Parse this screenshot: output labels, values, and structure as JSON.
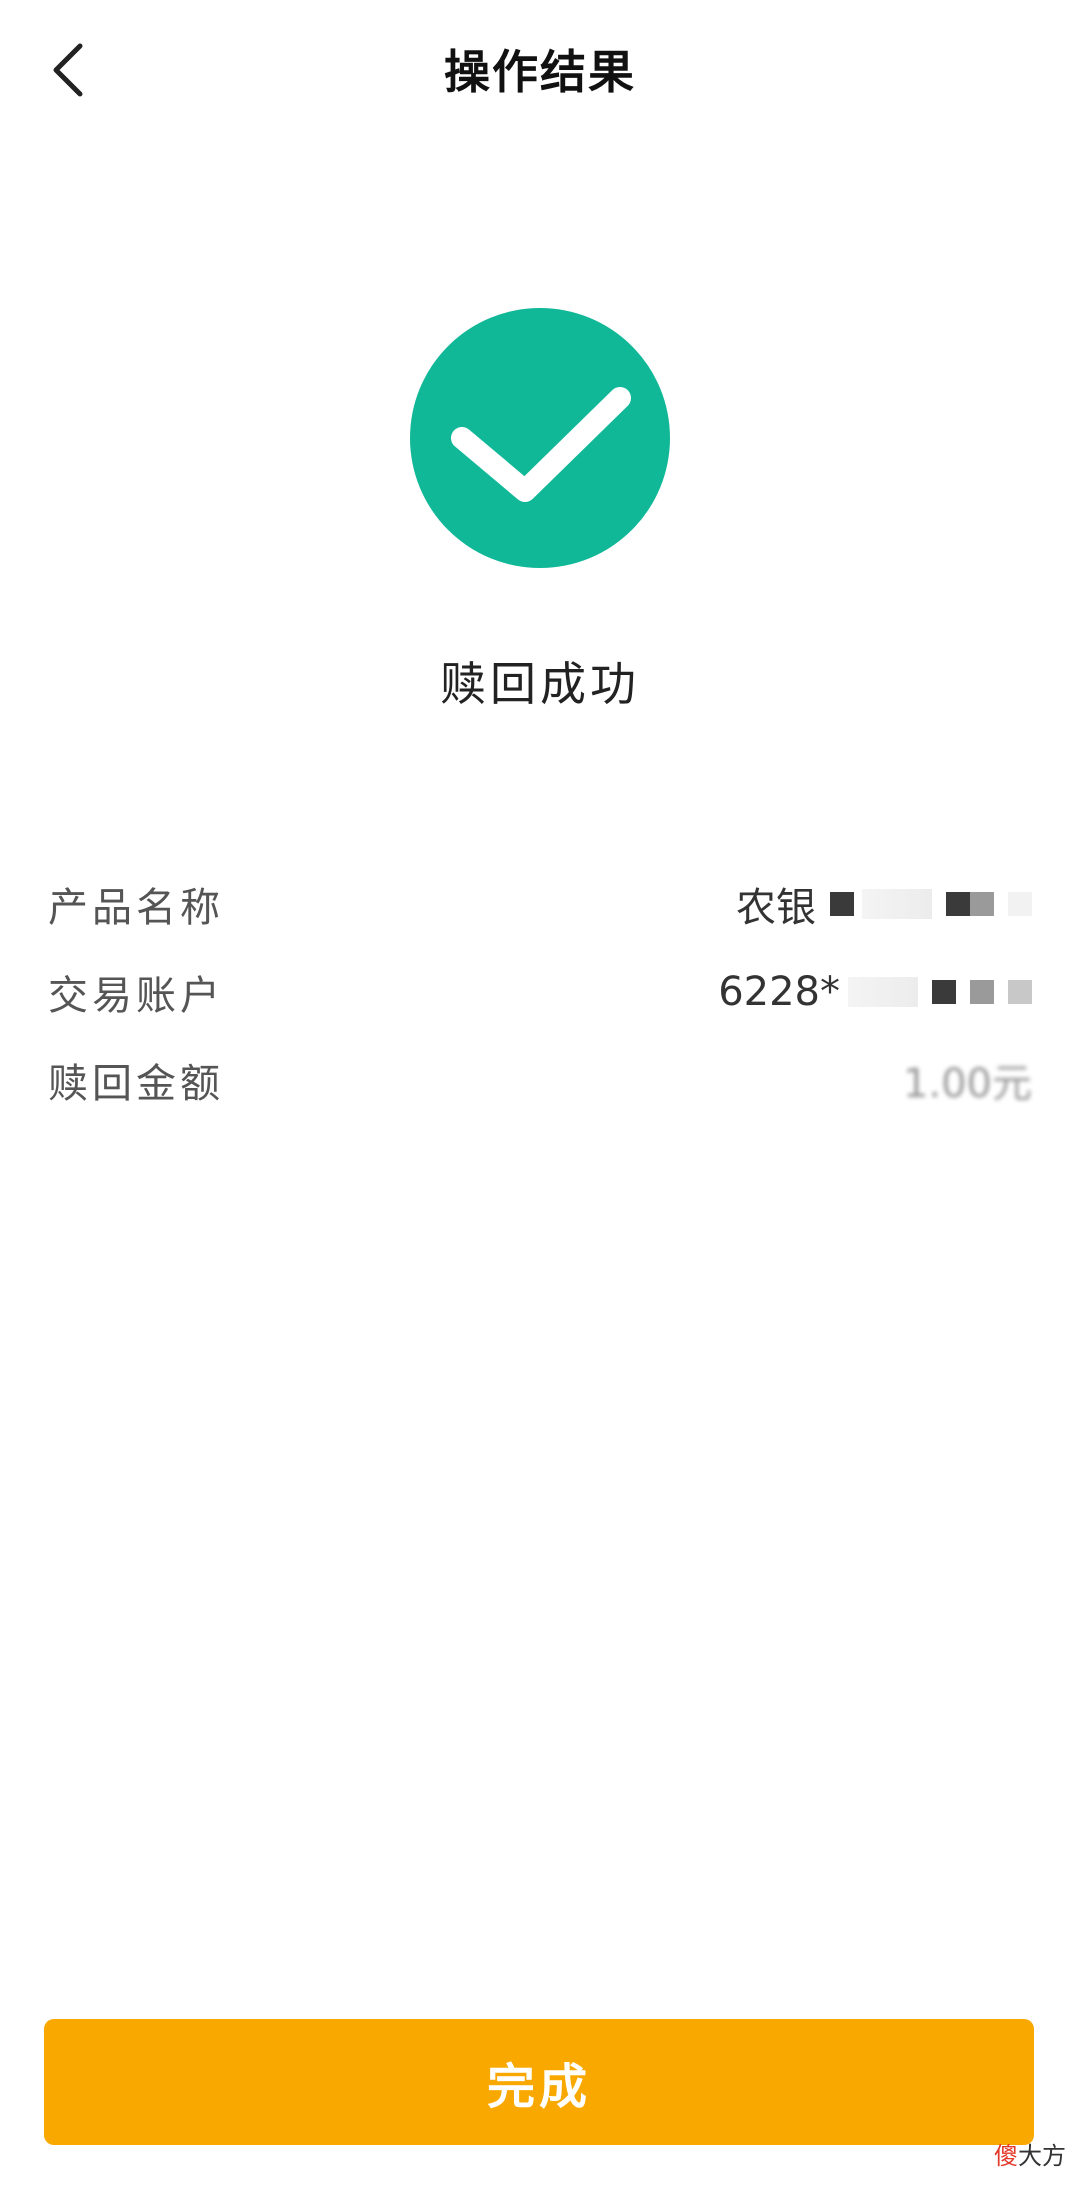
{
  "header": {
    "title": "操作结果",
    "back_icon": "chevron-left-icon"
  },
  "result": {
    "icon": "check-circle-icon",
    "icon_color": "#10B898",
    "text": "赎回成功"
  },
  "details": [
    {
      "label": "产品名称",
      "value": "农银"
    },
    {
      "label": "交易账户",
      "value": "6228*"
    },
    {
      "label": "赎回金额",
      "value": "1.00元"
    }
  ],
  "footer": {
    "done_label": "完成",
    "button_color": "#F9A800"
  },
  "watermark": {
    "accent": "傻",
    "rest": "大方"
  }
}
